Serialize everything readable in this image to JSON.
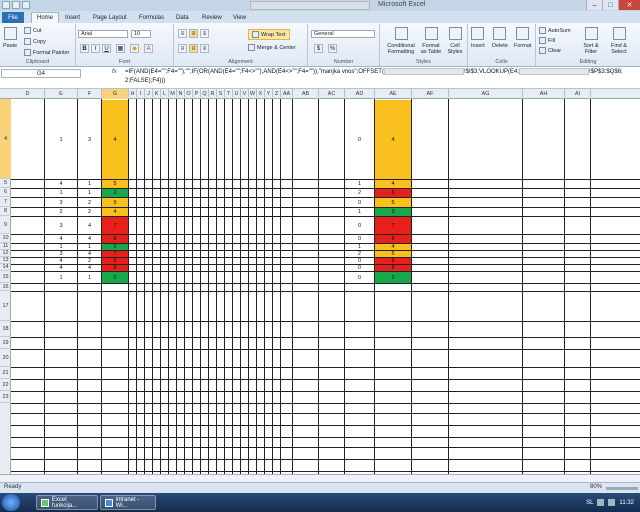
{
  "app": {
    "title": "Microsoft Excel"
  },
  "ribbon": {
    "tabs": [
      "File",
      "Home",
      "Insert",
      "Page Layout",
      "Formulas",
      "Data",
      "Review",
      "View"
    ],
    "active_tab": "Home",
    "clipboard": {
      "label": "Clipboard",
      "paste": "Paste",
      "cut": "Cut",
      "copy": "Copy",
      "format_painter": "Format Painter"
    },
    "font": {
      "label": "Font",
      "name": "Arial",
      "size": "10"
    },
    "alignment": {
      "label": "Alignment",
      "wrap_text": "Wrap Text",
      "merge": "Merge & Center"
    },
    "number": {
      "label": "Number",
      "format": "General",
      "currency": "$",
      "percent": "%"
    },
    "styles": {
      "label": "Styles",
      "conditional": "Conditional Formatting",
      "format_table": "Format as Table",
      "cell_styles": "Cell Styles"
    },
    "cells": {
      "label": "Cells",
      "insert": "Insert",
      "delete": "Delete",
      "format": "Format"
    },
    "editing": {
      "label": "Editing",
      "autosum": "AutoSum",
      "fill": "Fill",
      "clear": "Clear",
      "sort": "Sort & Filter",
      "find": "Find & Select"
    }
  },
  "formula_bar": {
    "name_box": "G4",
    "fx": "fx",
    "part1": "=IF(AND(E4=\"\";F4=\"\");\"\";IF(OR(AND(E4=\"\";F4<>\"\");AND(E4<>\"\";F4=\"\"));\"manjka vnos\";OFFSET(",
    "part2": "!$I$3;VLOOKUP(E4;",
    "part3": "!$P$3:$Q$6;",
    "part4": "2;FALSE);F4)))"
  },
  "grid": {
    "columns": [
      "D",
      "E",
      "F",
      "G",
      "H",
      "I",
      "J",
      "K",
      "L",
      "M",
      "N",
      "O",
      "P",
      "Q",
      "R",
      "S",
      "T",
      "U",
      "V",
      "W",
      "X",
      "Y",
      "Z",
      "AA",
      "AB",
      "AC",
      "AD",
      "AE",
      "AF",
      "AG",
      "AH",
      "AI"
    ],
    "selected_column": "G",
    "row_labels": [
      "4",
      "5",
      "6",
      "7",
      "8",
      "9",
      "10",
      "11",
      "12",
      "13",
      "14",
      "15",
      "16",
      "17",
      "18",
      "19",
      "20",
      "21",
      "22",
      "23"
    ],
    "selected_row": "4",
    "rows": [
      {
        "e": "1",
        "f": "3",
        "g": "4",
        "ad": "0",
        "ae": "4"
      },
      {
        "e": "4",
        "f": "1",
        "g": "5",
        "ad": "1",
        "ae": "4"
      },
      {
        "e": "1",
        "f": "1",
        "g": "2",
        "ad": "2",
        "ae": "6"
      },
      {
        "e": "3",
        "f": "2",
        "g": "5",
        "ad": "0",
        "ae": "5"
      },
      {
        "e": "2",
        "f": "2",
        "g": "4",
        "ad": "1",
        "ae": "3"
      },
      {
        "e": "3",
        "f": "4",
        "g": "7",
        "ad": "0",
        "ae": "7"
      },
      {
        "e": "4",
        "f": "4",
        "g": "8",
        "ad": "0",
        "ae": "8"
      },
      {
        "e": "1",
        "f": "1",
        "g": "2",
        "ad": "1",
        "ae": "4"
      },
      {
        "e": "3",
        "f": "4",
        "g": "7",
        "ad": "2",
        "ae": "5"
      },
      {
        "e": "4",
        "f": "2",
        "g": "6",
        "ad": "0",
        "ae": "6"
      },
      {
        "e": "4",
        "f": "4",
        "g": "8",
        "ad": "0",
        "ae": "8"
      },
      {
        "e": "1",
        "f": "1",
        "g": "2",
        "ad": "0",
        "ae": "2"
      }
    ],
    "colors": {
      "orange": "#f9c01e",
      "green": "#16a84a",
      "red": "#e8201c"
    }
  },
  "status": {
    "ready": "Ready",
    "zoom": "80%"
  },
  "taskbar": {
    "items": [
      "Excel funkcija...",
      "intranet - Wi..."
    ],
    "lang": "SL",
    "time": "11:32"
  }
}
